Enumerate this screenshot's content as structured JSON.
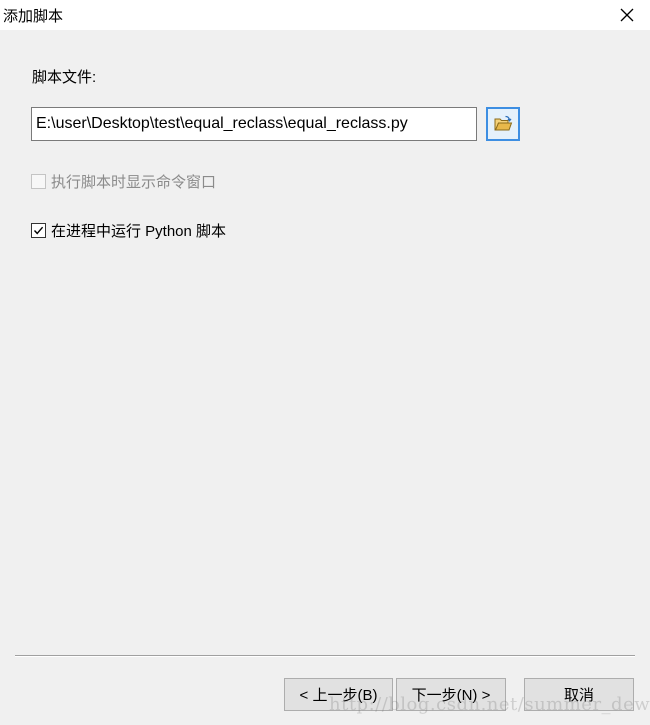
{
  "window": {
    "title": "添加脚本",
    "close_icon": "close-icon"
  },
  "script_file": {
    "label": "脚本文件:",
    "path_value": "E:\\user\\Desktop\\test\\equal_reclass\\equal_reclass.py",
    "browse_icon": "open-folder-icon"
  },
  "options": {
    "show_command_window": {
      "label": "执行脚本时显示命令窗口",
      "checked": false,
      "enabled": false
    },
    "run_in_process": {
      "label": "在进程中运行 Python 脚本",
      "checked": true,
      "enabled": true
    }
  },
  "footer": {
    "back_label": "< 上一步(B)",
    "next_label": "下一步(N) >",
    "cancel_label": "取消"
  },
  "watermark": {
    "text": "http://blog.csdn.net/summer_dew"
  },
  "colors": {
    "accent": "#3d8ee2",
    "dialog_background": "#f0f0f0",
    "button_background": "#e1e1e1",
    "folder": "#e8b84a"
  }
}
